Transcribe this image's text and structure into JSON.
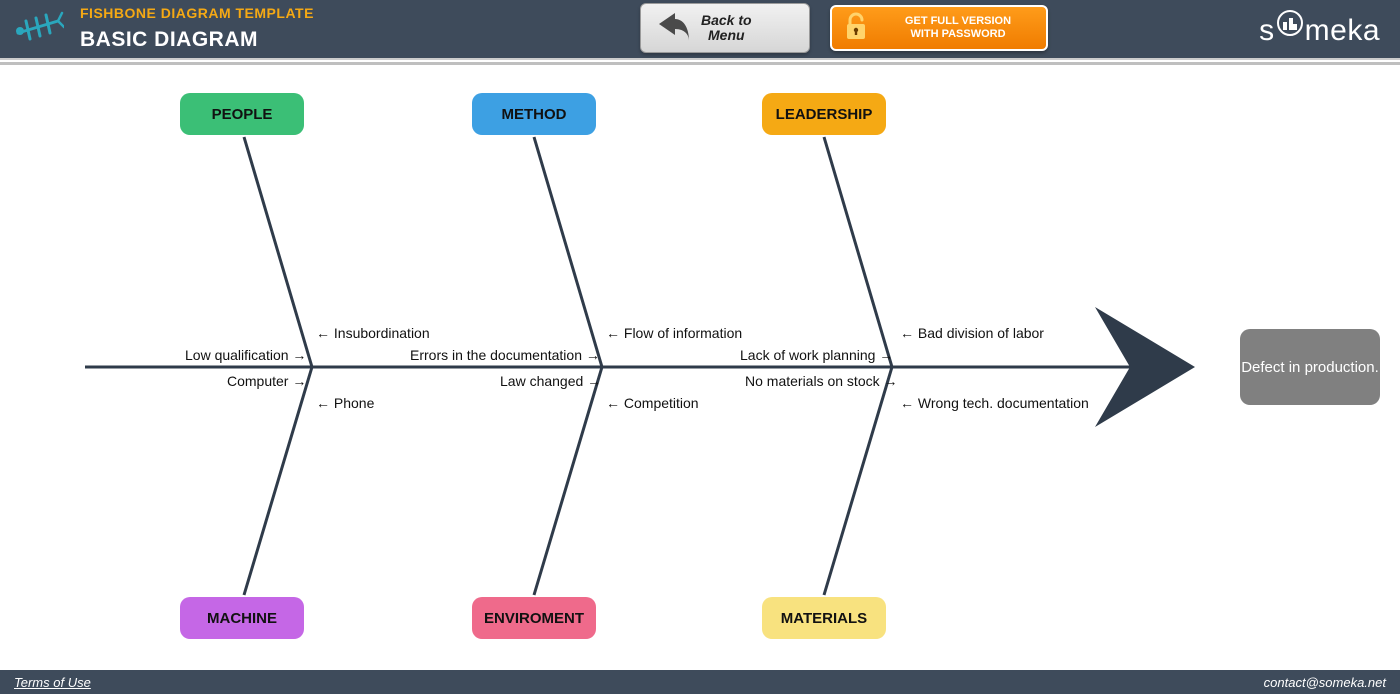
{
  "header": {
    "title_sup": "FISHBONE DIAGRAM TEMPLATE",
    "title_main": "BASIC DIAGRAM",
    "back_line1": "Back to",
    "back_line2": "Menu",
    "full_line1": "GET FULL VERSION",
    "full_line2": "WITH PASSWORD",
    "brand": "someka"
  },
  "diagram": {
    "effect": "Defect in production.",
    "categories": {
      "top": [
        {
          "name": "PEOPLE",
          "color": "green"
        },
        {
          "name": "METHOD",
          "color": "blue"
        },
        {
          "name": "LEADERSHIP",
          "color": "orange"
        }
      ],
      "bottom": [
        {
          "name": "MACHINE",
          "color": "purple"
        },
        {
          "name": "ENVIROMENT",
          "color": "pink"
        },
        {
          "name": "MATERIALS",
          "color": "yellow"
        }
      ]
    },
    "causes": {
      "top": [
        {
          "text": "← Insubordination"
        },
        {
          "text": "Low qualification →"
        },
        {
          "text": "← Flow of information"
        },
        {
          "text": "Errors in the documentation →"
        },
        {
          "text": "← Bad division of labor"
        },
        {
          "text": "Lack of work planning →"
        }
      ],
      "bottom": [
        {
          "text": "Computer →"
        },
        {
          "text": "← Phone"
        },
        {
          "text": "Law changed →"
        },
        {
          "text": "← Competition"
        },
        {
          "text": "No materials on stock →"
        },
        {
          "text": "← Wrong  tech. documentation"
        }
      ]
    }
  },
  "footer": {
    "terms": "Terms of Use",
    "contact": "contact@someka.net"
  }
}
